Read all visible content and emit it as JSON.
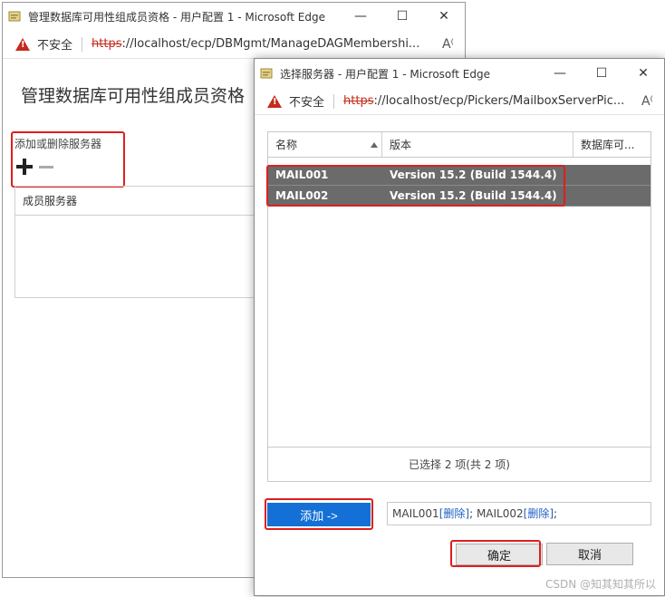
{
  "back_window": {
    "title": "管理数据库可用性组成员资格 - 用户配置 1 - Microsoft Edge",
    "address": {
      "insecure_label": "不安全",
      "url_scheme": "https",
      "url_rest": "://localhost/ecp/DBMgmt/ManageDAGMembershi..."
    },
    "page_title": "管理数据库可用性组成员资格",
    "add_remove_label": "添加或删除服务器",
    "member_list_header": "成员服务器"
  },
  "dialog": {
    "title": "选择服务器 - 用户配置 1 - Microsoft Edge",
    "address": {
      "insecure_label": "不安全",
      "url_scheme": "https",
      "url_rest": "://localhost/ecp/Pickers/MailboxServerPic..."
    },
    "grid": {
      "columns": [
        "名称",
        "版本",
        "数据库可..."
      ],
      "rows": [
        {
          "name": "MAIL001",
          "version": "Version 15.2 (Build 1544.4)",
          "db": ""
        },
        {
          "name": "MAIL002",
          "version": "Version 15.2 (Build 1544.4)",
          "db": ""
        }
      ],
      "footer": "已选择 2 项(共 2 项)"
    },
    "add_button": "添加 ->",
    "selected": {
      "item1": "MAIL001",
      "item1_action": "[删除]",
      "sep": "; ",
      "item2": "MAIL002",
      "item2_action": "[删除]",
      "end": ";"
    },
    "ok_button": "确定",
    "cancel_button": "取消"
  },
  "watermark": "CSDN @知其知其所以"
}
